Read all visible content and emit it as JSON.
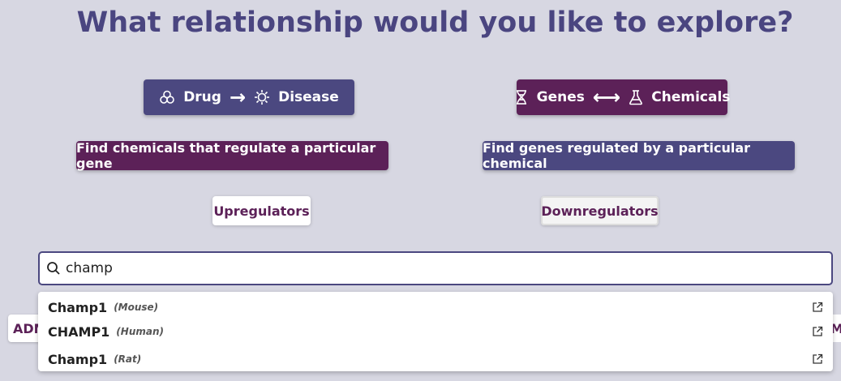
{
  "title": "What relationship would you like to explore?",
  "modes": {
    "drug_disease": {
      "left": "Drug",
      "right": "Disease",
      "arrow": "→"
    },
    "genes_chemicals": {
      "left": "Genes",
      "right": "Chemicals",
      "arrow": "⟷"
    }
  },
  "find": {
    "chemicals_label": "Find chemicals that regulate a particular gene",
    "genes_label": "Find genes regulated by a particular chemical"
  },
  "regulators": {
    "up_label": "Upregulators",
    "down_label": "Downregulators"
  },
  "search": {
    "value": "champ"
  },
  "side": {
    "left_label": "ADM",
    "right_label": "MA"
  },
  "dropdown": {
    "items": [
      {
        "name": "Champ1",
        "species": "(Mouse)"
      },
      {
        "name": "CHAMP1",
        "species": "(Human)"
      },
      {
        "name": "Champ1",
        "species": "(Rat)"
      }
    ]
  },
  "colors": {
    "background": "#d7d7e2",
    "indigo": "#4b4880",
    "plum": "#5c2158",
    "title": "#4a4580"
  }
}
